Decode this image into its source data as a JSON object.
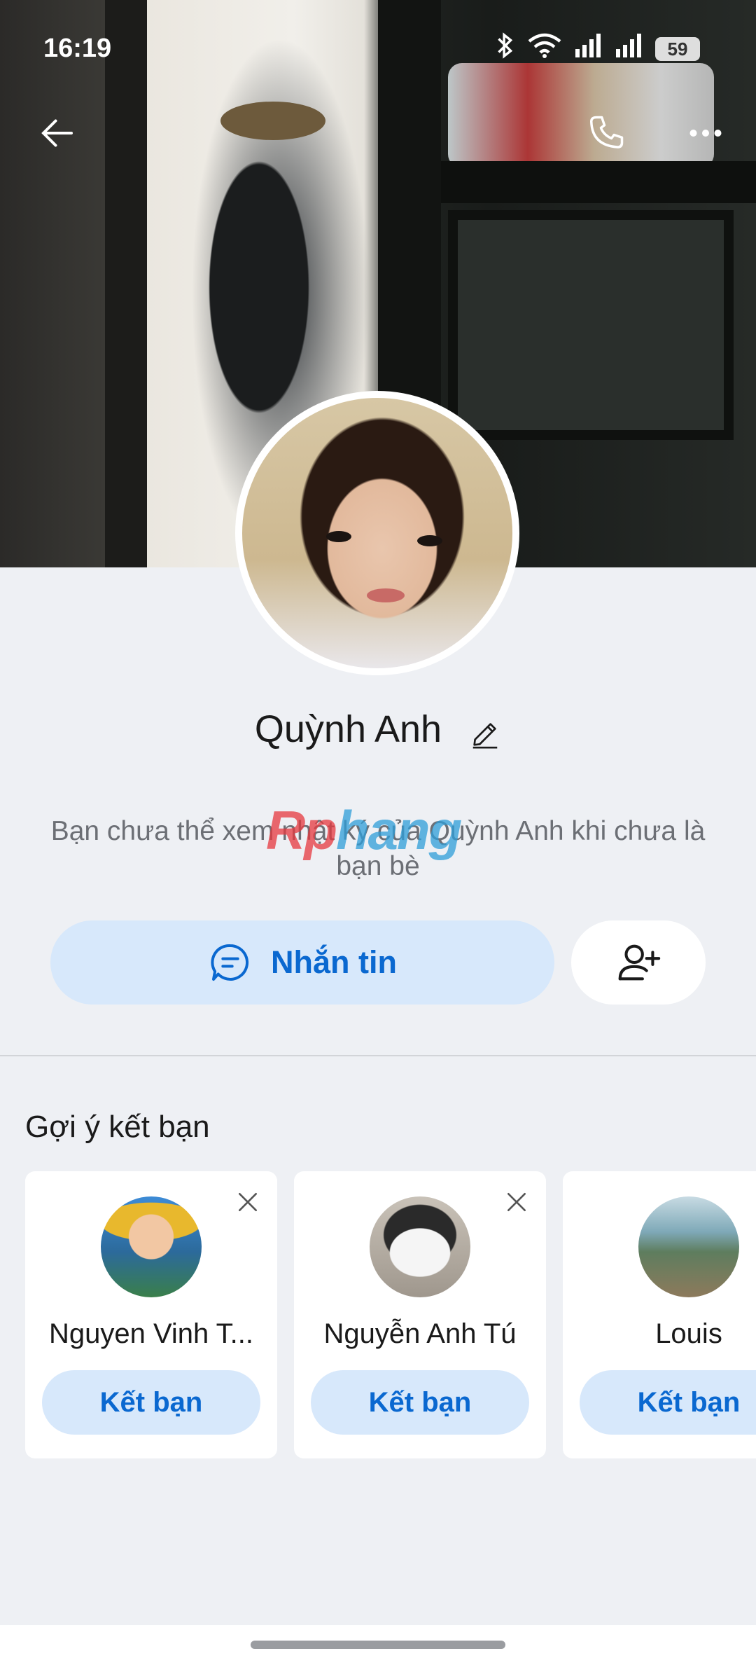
{
  "status_bar": {
    "time": "16:19",
    "battery": "59",
    "icons": [
      "bluetooth-icon",
      "wifi-icon",
      "signal-icon",
      "signal-icon"
    ]
  },
  "top_actions": {
    "back_icon": "arrow-left-icon",
    "call_icon": "phone-icon",
    "more_icon": "more-horizontal-icon"
  },
  "profile": {
    "name": "Quỳnh Anh",
    "edit_icon": "pencil-icon",
    "privacy_note": "Bạn chưa thể xem nhật ký của Quỳnh Anh khi chưa là bạn bè"
  },
  "watermark": {
    "part1": "Rp",
    "part2": "hang"
  },
  "actions": {
    "message_label": "Nhắn tin",
    "message_icon": "chat-bubble-icon",
    "add_friend_icon": "add-user-icon"
  },
  "suggestions": {
    "title": "Gợi ý kết bạn",
    "items": [
      {
        "name": "Nguyen Vinh T...",
        "button": "Kết bạn"
      },
      {
        "name": "Nguyễn Anh Tú",
        "button": "Kết bạn"
      },
      {
        "name": "Louis",
        "button": "Kết bạn"
      }
    ]
  },
  "colors": {
    "accent": "#0a68d0",
    "button_bg": "#d7e8fb",
    "page_bg": "#eef0f4"
  }
}
